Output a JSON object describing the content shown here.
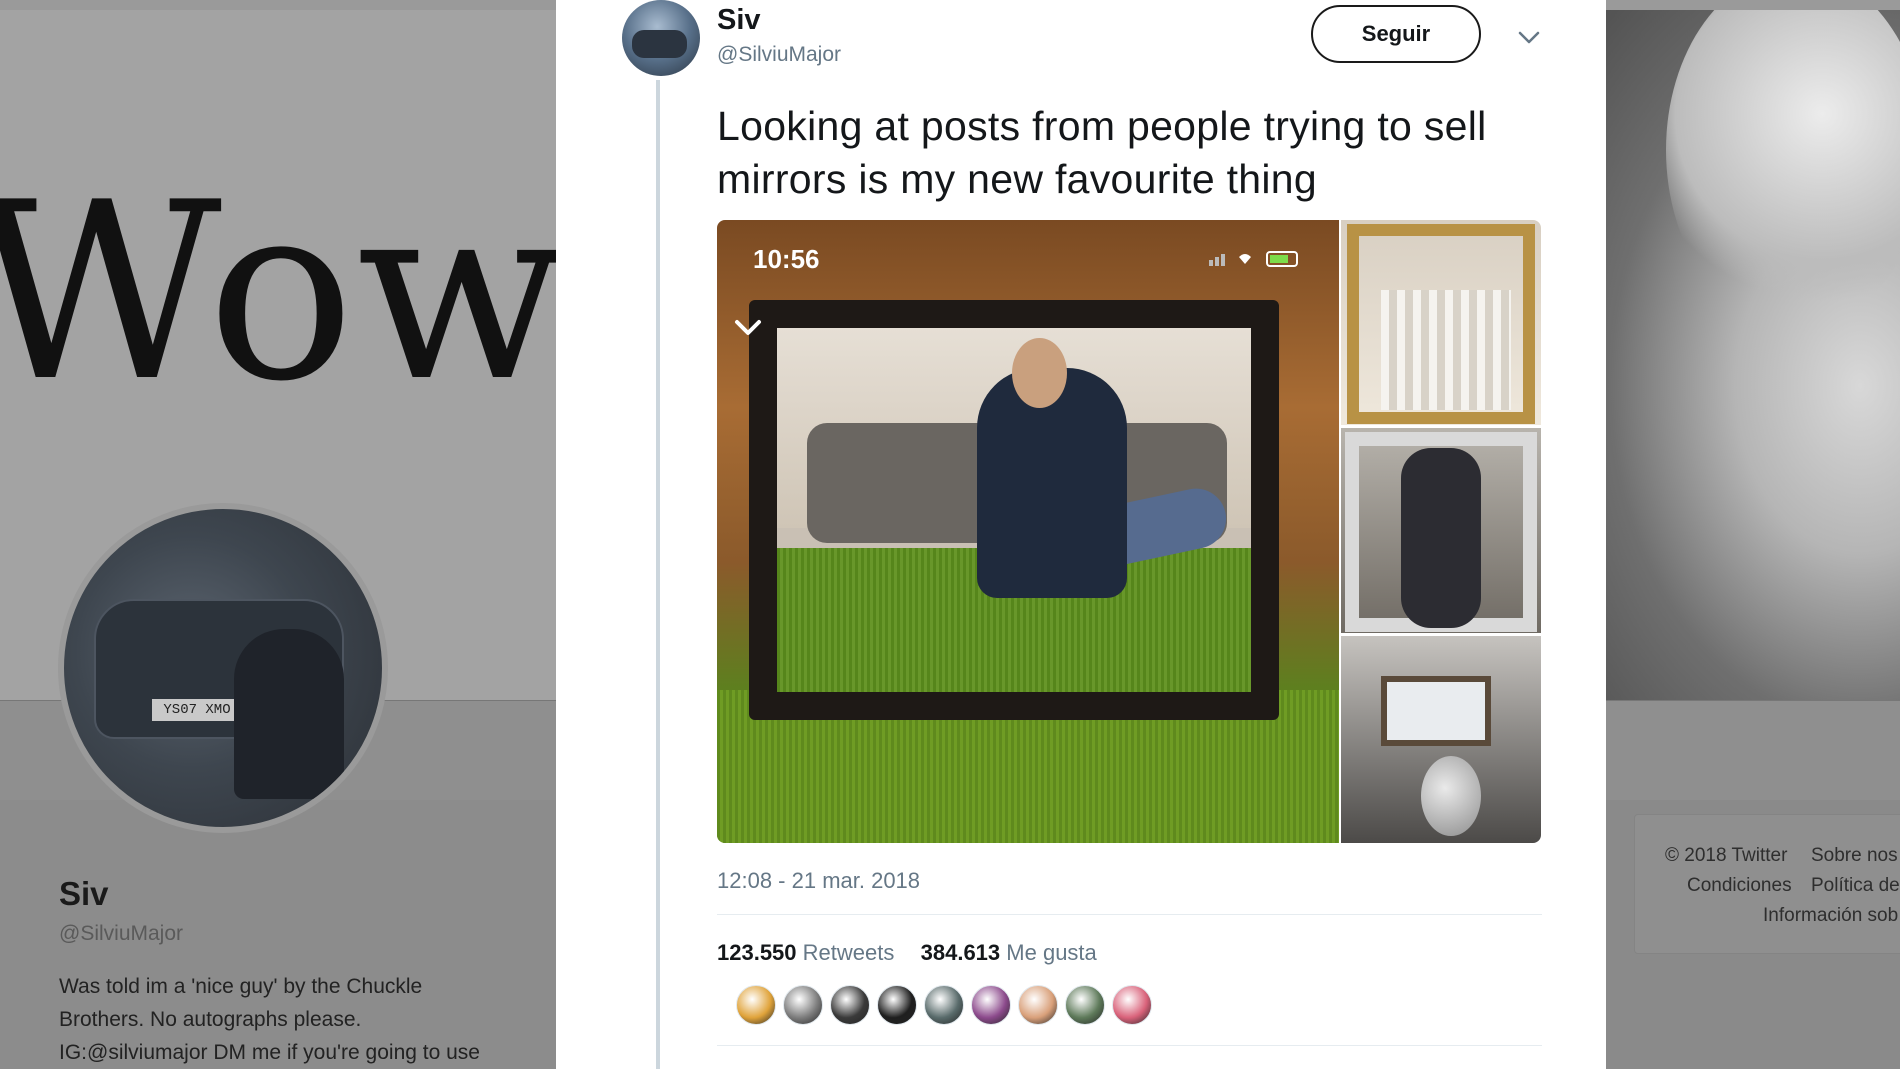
{
  "background_profile": {
    "header_text": "Wow",
    "plate_text": "YS07 XMO",
    "name": "Siv",
    "handle": "@SilviuMajor",
    "bio_lines": [
      "Was told im a 'nice guy' by the Chuckle",
      "Brothers. No autographs please.",
      "IG:@silviumajor DM me if you're going to use"
    ],
    "footer": {
      "line1a": "© 2018 Twitter",
      "line1b": "Sobre nos",
      "line2a": "Condiciones",
      "line2b": "Política de",
      "line3": "Información sob"
    }
  },
  "tweet": {
    "author_name": "Siv",
    "author_handle": "@SilviuMajor",
    "follow_label": "Seguir",
    "caret_icon": "chevron-down-icon",
    "text": "Looking at posts from people trying to sell mirrors is my new favourite thing",
    "media": {
      "status_time": "10:56",
      "thumb_time": "10:56"
    },
    "timestamp": "12:08 - 21 mar. 2018",
    "stats": {
      "retweets_count": "123.550",
      "retweets_label": "Retweets",
      "likes_count": "384.613",
      "likes_label": "Me gusta"
    },
    "likers": [
      {
        "color": "#e0a33a"
      },
      {
        "color": "#7d7d7d"
      },
      {
        "color": "#3a3a3a"
      },
      {
        "color": "#1f1f1f"
      },
      {
        "color": "#596b6b"
      },
      {
        "color": "#8c4a8c"
      },
      {
        "color": "#d9a07a"
      },
      {
        "color": "#5e7a5a"
      },
      {
        "color": "#d9627a"
      }
    ]
  },
  "colors": {
    "text_primary": "#14171a",
    "text_secondary": "#657786",
    "separator": "#e6ecf0"
  }
}
